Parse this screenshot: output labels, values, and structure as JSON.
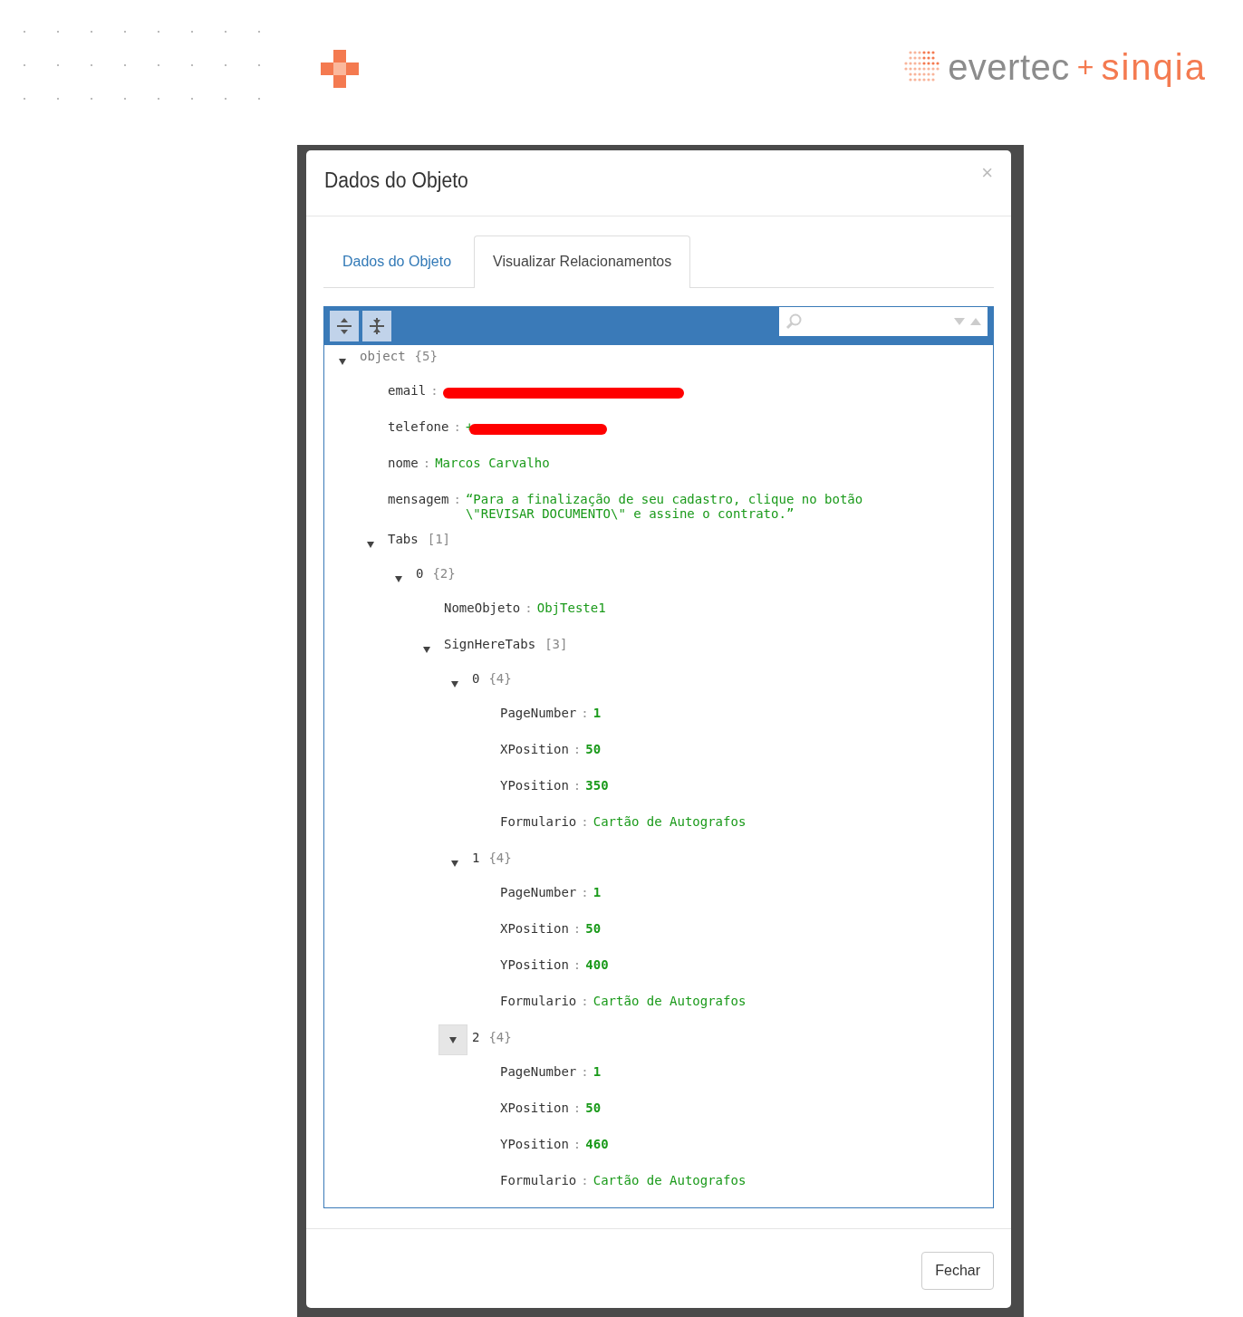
{
  "brand": {
    "company": "evertec",
    "joiner": "+",
    "partner": "sinqia"
  },
  "dialog": {
    "title": "Dados do Objeto",
    "close": "×",
    "tabs": [
      {
        "label": "Dados do Objeto",
        "selected": false
      },
      {
        "label": "Visualizar Relacionamentos",
        "selected": true
      }
    ],
    "tree": {
      "key": "object",
      "kind": "object",
      "count": "{5}",
      "expanded": true,
      "children": [
        {
          "key": "email",
          "sep": ":",
          "kind": "redacted"
        },
        {
          "key": "telefone",
          "sep": ":",
          "kind": "redacted",
          "value": "+"
        },
        {
          "key": "nome",
          "sep": ":",
          "kind": "string",
          "value": "Marcos Carvalho"
        },
        {
          "key": "mensagem",
          "sep": ":",
          "kind": "string",
          "value": "“Para a finalização de seu cadastro, clique no botão \\\"REVISAR DOCUMENTO\\\" e assine o contrato.”"
        },
        {
          "key": "Tabs",
          "kind": "array",
          "count": "[1]",
          "expanded": true,
          "children": [
            {
              "key": "0",
              "kind": "object",
              "count": "{2}",
              "expanded": true,
              "children": [
                {
                  "key": "NomeObjeto",
                  "sep": ":",
                  "kind": "string",
                  "value": "ObjTeste1"
                },
                {
                  "key": "SignHereTabs",
                  "kind": "array",
                  "count": "[3]",
                  "expanded": true,
                  "children": [
                    {
                      "key": "0",
                      "kind": "object",
                      "count": "{4}",
                      "expanded": true,
                      "children": [
                        {
                          "key": "PageNumber",
                          "sep": ":",
                          "kind": "number",
                          "value": "1"
                        },
                        {
                          "key": "XPosition",
                          "sep": ":",
                          "kind": "number",
                          "value": "50"
                        },
                        {
                          "key": "YPosition",
                          "sep": ":",
                          "kind": "number",
                          "value": "350"
                        },
                        {
                          "key": "Formulario",
                          "sep": ":",
                          "kind": "string",
                          "value": "Cartão de Autografos"
                        }
                      ]
                    },
                    {
                      "key": "1",
                      "kind": "object",
                      "count": "{4}",
                      "expanded": true,
                      "children": [
                        {
                          "key": "PageNumber",
                          "sep": ":",
                          "kind": "number",
                          "value": "1"
                        },
                        {
                          "key": "XPosition",
                          "sep": ":",
                          "kind": "number",
                          "value": "50"
                        },
                        {
                          "key": "YPosition",
                          "sep": ":",
                          "kind": "number",
                          "value": "400"
                        },
                        {
                          "key": "Formulario",
                          "sep": ":",
                          "kind": "string",
                          "value": "Cartão de Autografos"
                        }
                      ]
                    },
                    {
                      "key": "2",
                      "kind": "object",
                      "count": "{4}",
                      "expanded": true,
                      "hovered": true,
                      "children": [
                        {
                          "key": "PageNumber",
                          "sep": ":",
                          "kind": "number",
                          "value": "1"
                        },
                        {
                          "key": "XPosition",
                          "sep": ":",
                          "kind": "number",
                          "value": "50"
                        },
                        {
                          "key": "YPosition",
                          "sep": ":",
                          "kind": "number",
                          "value": "460"
                        },
                        {
                          "key": "Formulario",
                          "sep": ":",
                          "kind": "string",
                          "value": "Cartão de Autografos"
                        }
                      ]
                    }
                  ]
                }
              ]
            }
          ]
        }
      ]
    },
    "footer_button": "Fechar"
  }
}
